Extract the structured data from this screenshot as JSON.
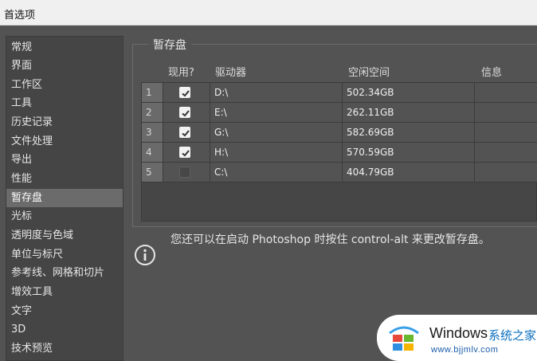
{
  "window": {
    "title": "首选项"
  },
  "sidebar": {
    "items": [
      {
        "label": "常规"
      },
      {
        "label": "界面"
      },
      {
        "label": "工作区"
      },
      {
        "label": "工具"
      },
      {
        "label": "历史记录"
      },
      {
        "label": "文件处理"
      },
      {
        "label": "导出"
      },
      {
        "label": "性能"
      },
      {
        "label": "暂存盘"
      },
      {
        "label": "光标"
      },
      {
        "label": "透明度与色域"
      },
      {
        "label": "单位与标尺"
      },
      {
        "label": "参考线、网格和切片"
      },
      {
        "label": "增效工具"
      },
      {
        "label": "文字"
      },
      {
        "label": "3D"
      },
      {
        "label": "技术预览"
      }
    ],
    "active_index": 8
  },
  "scratch": {
    "group_title": "暂存盘",
    "columns": {
      "active": "现用?",
      "drive": "驱动器",
      "free": "空闲空间",
      "info": "信息"
    },
    "rows": [
      {
        "num": "1",
        "checked": true,
        "drive": "D:\\",
        "free": "502.34GB",
        "info": ""
      },
      {
        "num": "2",
        "checked": true,
        "drive": "E:\\",
        "free": "262.11GB",
        "info": ""
      },
      {
        "num": "3",
        "checked": true,
        "drive": "G:\\",
        "free": "582.69GB",
        "info": ""
      },
      {
        "num": "4",
        "checked": true,
        "drive": "H:\\",
        "free": "570.59GB",
        "info": ""
      },
      {
        "num": "5",
        "checked": false,
        "drive": "C:\\",
        "free": "404.79GB",
        "info": ""
      }
    ],
    "hint": "您还可以在启动 Photoshop 时按住 control-alt 来更改暂存盘。"
  },
  "watermark": {
    "brand": "Windows",
    "brand_cn": "系统之家",
    "url": "www.bjjmlv.com"
  }
}
